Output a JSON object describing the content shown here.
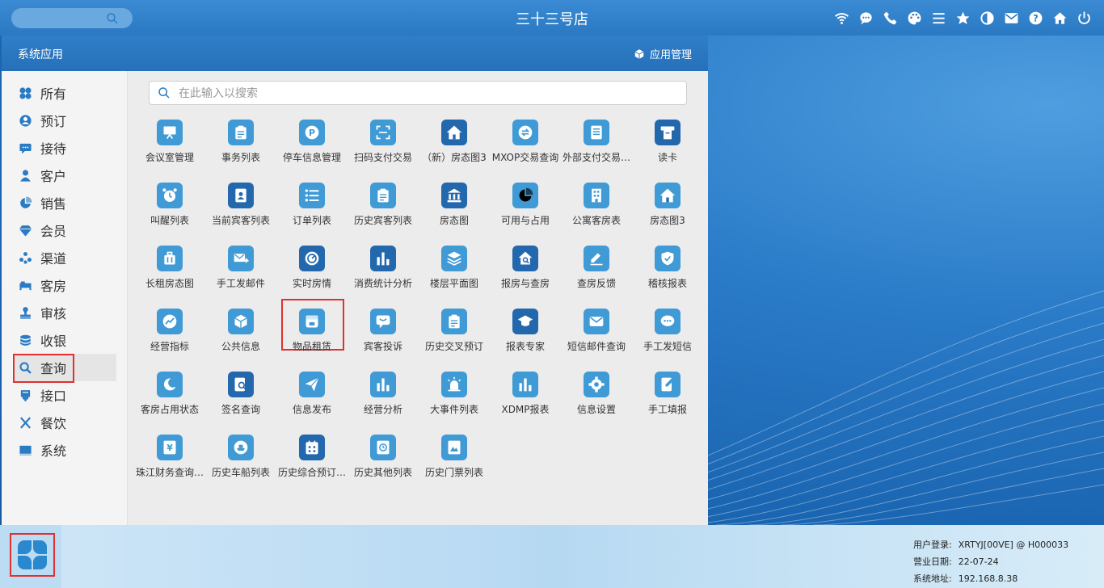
{
  "top_bar": {
    "title": "三十三号店",
    "icons": [
      "wifi-icon",
      "chat-icon",
      "phone-icon",
      "palette-icon",
      "menu-icon",
      "star-icon",
      "contrast-icon",
      "mail-icon",
      "help-icon",
      "home-icon",
      "power-icon"
    ]
  },
  "window": {
    "title": "系统应用",
    "manage_label": "应用管理"
  },
  "sidebar": {
    "items": [
      {
        "label": "所有",
        "icon": "grid-icon"
      },
      {
        "label": "预订",
        "icon": "user-circle-icon"
      },
      {
        "label": "接待",
        "icon": "chat-icon"
      },
      {
        "label": "客户",
        "icon": "person-icon"
      },
      {
        "label": "销售",
        "icon": "pie-icon"
      },
      {
        "label": "会员",
        "icon": "diamond-icon"
      },
      {
        "label": "渠道",
        "icon": "group-icon"
      },
      {
        "label": "客房",
        "icon": "bed-icon"
      },
      {
        "label": "审核",
        "icon": "stamp-icon"
      },
      {
        "label": "收银",
        "icon": "coins-icon"
      },
      {
        "label": "查询",
        "icon": "search-icon"
      },
      {
        "label": "接口",
        "icon": "plug-icon"
      },
      {
        "label": "餐饮",
        "icon": "utensils-icon"
      },
      {
        "label": "系统",
        "icon": "monitor-icon"
      }
    ],
    "active_index": 10
  },
  "search": {
    "placeholder": "在此输入以搜索"
  },
  "apps": [
    {
      "label": "会议室管理",
      "icon": "presentation-icon",
      "color": "#3f9ad6"
    },
    {
      "label": "事务列表",
      "icon": "clipboard-icon",
      "color": "#3f9ad6"
    },
    {
      "label": "停车信息管理",
      "icon": "parking-icon",
      "color": "#3f9ad6"
    },
    {
      "label": "扫码支付交易",
      "icon": "scan-icon",
      "color": "#3f9ad6"
    },
    {
      "label": "（新）房态图3",
      "icon": "house-icon",
      "color": "#2368ad"
    },
    {
      "label": "MXOP交易查询",
      "icon": "exchange-icon",
      "color": "#3f9ad6"
    },
    {
      "label": "外部支付交易…",
      "icon": "receipt-icon",
      "color": "#3f9ad6"
    },
    {
      "label": "读卡",
      "icon": "card-reader-icon",
      "color": "#2368ad"
    },
    {
      "label": "叫醒列表",
      "icon": "alarm-icon",
      "color": "#3f9ad6"
    },
    {
      "label": "当前宾客列表",
      "icon": "id-badge-icon",
      "color": "#2368ad"
    },
    {
      "label": "订单列表",
      "icon": "list-icon",
      "color": "#3f9ad6"
    },
    {
      "label": "历史宾客列表",
      "icon": "clipboard-icon",
      "color": "#3f9ad6"
    },
    {
      "label": "房态图",
      "icon": "bank-icon",
      "color": "#2368ad"
    },
    {
      "label": "可用与占用",
      "icon": "pie-icon",
      "color": "#3f9ad6"
    },
    {
      "label": "公寓客房表",
      "icon": "building-icon",
      "color": "#3f9ad6"
    },
    {
      "label": "房态图3",
      "icon": "house-icon",
      "color": "#3f9ad6"
    },
    {
      "label": "长租房态图",
      "icon": "luggage-icon",
      "color": "#3f9ad6"
    },
    {
      "label": "手工发邮件",
      "icon": "send-mail-icon",
      "color": "#3f9ad6"
    },
    {
      "label": "实时房情",
      "icon": "gauge-icon",
      "color": "#2368ad"
    },
    {
      "label": "消费统计分析",
      "icon": "bar-chart-icon",
      "color": "#2368ad"
    },
    {
      "label": "楼层平面图",
      "icon": "layers-icon",
      "color": "#3f9ad6"
    },
    {
      "label": "报房与查房",
      "icon": "house-search-icon",
      "color": "#2368ad"
    },
    {
      "label": "查房反馈",
      "icon": "edit-icon",
      "color": "#3f9ad6"
    },
    {
      "label": "稽核报表",
      "icon": "shield-icon",
      "color": "#3f9ad6"
    },
    {
      "label": "经营指标",
      "icon": "trend-icon",
      "color": "#3f9ad6"
    },
    {
      "label": "公共信息",
      "icon": "box-icon",
      "color": "#3f9ad6"
    },
    {
      "label": "物品租赁",
      "icon": "shop-icon",
      "color": "#3f9ad6"
    },
    {
      "label": "宾客投诉",
      "icon": "comment-icon",
      "color": "#3f9ad6"
    },
    {
      "label": "历史交叉预订",
      "icon": "clipboard-icon",
      "color": "#3f9ad6"
    },
    {
      "label": "报表专家",
      "icon": "graduation-icon",
      "color": "#2368ad"
    },
    {
      "label": "短信邮件查询",
      "icon": "mail-icon",
      "color": "#3f9ad6"
    },
    {
      "label": "手工发短信",
      "icon": "sms-icon",
      "color": "#3f9ad6"
    },
    {
      "label": "客房占用状态",
      "icon": "moon-icon",
      "color": "#3f9ad6"
    },
    {
      "label": "签名查询",
      "icon": "doc-search-icon",
      "color": "#2368ad"
    },
    {
      "label": "信息发布",
      "icon": "paper-plane-icon",
      "color": "#3f9ad6"
    },
    {
      "label": "经营分析",
      "icon": "bar-chart-icon",
      "color": "#3f9ad6"
    },
    {
      "label": "大事件列表",
      "icon": "siren-icon",
      "color": "#3f9ad6"
    },
    {
      "label": "XDMP报表",
      "icon": "bar-chart-icon",
      "color": "#3f9ad6"
    },
    {
      "label": "信息设置",
      "icon": "gear-icon",
      "color": "#3f9ad6"
    },
    {
      "label": "手工填报",
      "icon": "form-edit-icon",
      "color": "#3f9ad6"
    },
    {
      "label": "珠江财务查询…",
      "icon": "yen-icon",
      "color": "#3f9ad6"
    },
    {
      "label": "历史车船列表",
      "icon": "ship-icon",
      "color": "#3f9ad6"
    },
    {
      "label": "历史综合预订…",
      "icon": "calendar-icon",
      "color": "#2368ad"
    },
    {
      "label": "历史其他列表",
      "icon": "clock-doc-icon",
      "color": "#3f9ad6"
    },
    {
      "label": "历史门票列表",
      "icon": "ticket-icon",
      "color": "#3f9ad6"
    }
  ],
  "highlighted_app_index": 26,
  "taskbar": {
    "start_icon": "clover-icon",
    "info": [
      {
        "label": "用户登录:",
        "value": "XRTYJ[00VE] @ H000033"
      },
      {
        "label": "营业日期:",
        "value": "22-07-24"
      },
      {
        "label": "系统地址:",
        "value": "192.168.8.38"
      }
    ]
  }
}
